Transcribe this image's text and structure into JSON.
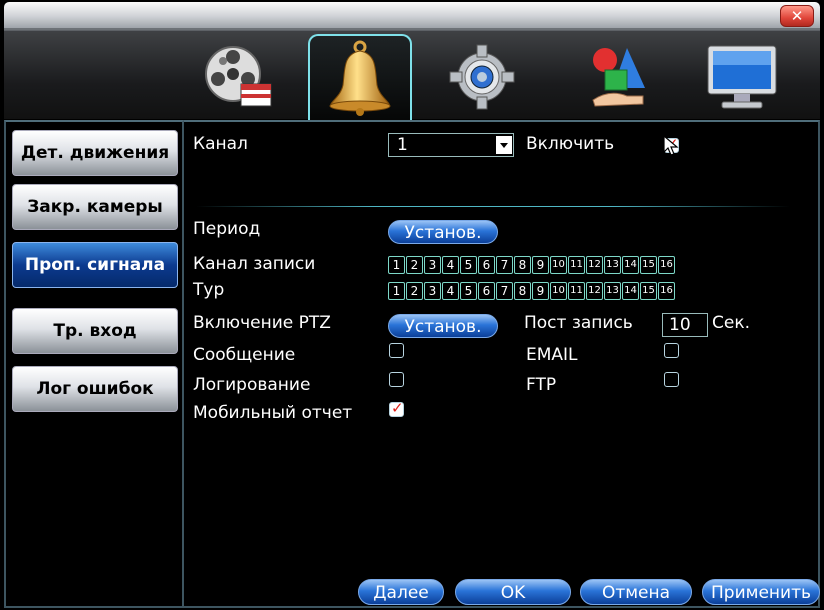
{
  "window": {
    "close_glyph": "✕"
  },
  "tabs": [
    {
      "icon": "film-reel-icon",
      "active": false
    },
    {
      "icon": "bell-icon",
      "active": true
    },
    {
      "icon": "gear-icon",
      "active": false
    },
    {
      "icon": "shapes-hand-icon",
      "active": false
    },
    {
      "icon": "monitor-icon",
      "active": false
    }
  ],
  "sidebar": {
    "items": [
      {
        "label": "Дет. движения",
        "active": false
      },
      {
        "label": "Закр. камеры",
        "active": false
      },
      {
        "label": "Проп. сигнала",
        "active": true
      },
      {
        "label": "Тр. вход",
        "active": false
      },
      {
        "label": "Лог ошибок",
        "active": false
      }
    ]
  },
  "form": {
    "channel_label": "Канал",
    "channel_value": "1",
    "enable_label": "Включить",
    "enable_checked": true,
    "period_label": "Период",
    "set_button": "Установ.",
    "record_channel_label": "Канал записи",
    "tour_label": "Тур",
    "channels": [
      "1",
      "2",
      "3",
      "4",
      "5",
      "6",
      "7",
      "8",
      "9",
      "10",
      "11",
      "12",
      "13",
      "14",
      "15",
      "16"
    ],
    "ptz_label": "Включение PTZ",
    "post_record_label": "Пост запись",
    "post_record_value": "10",
    "post_record_unit": "Сек.",
    "message_label": "Сообщение",
    "message_checked": false,
    "email_label": "EMAIL",
    "email_checked": false,
    "logging_label": "Логирование",
    "logging_checked": false,
    "ftp_label": "FTP",
    "ftp_checked": false,
    "mobile_label": "Мобильный отчет",
    "mobile_checked": true
  },
  "footer": {
    "next": "Далее",
    "ok": "OK",
    "cancel": "Отмена",
    "apply": "Применить"
  },
  "colors": {
    "accent": "#2a74d8",
    "active_tab_border": "#7fe1ea",
    "checkmark": "#e0201a"
  }
}
